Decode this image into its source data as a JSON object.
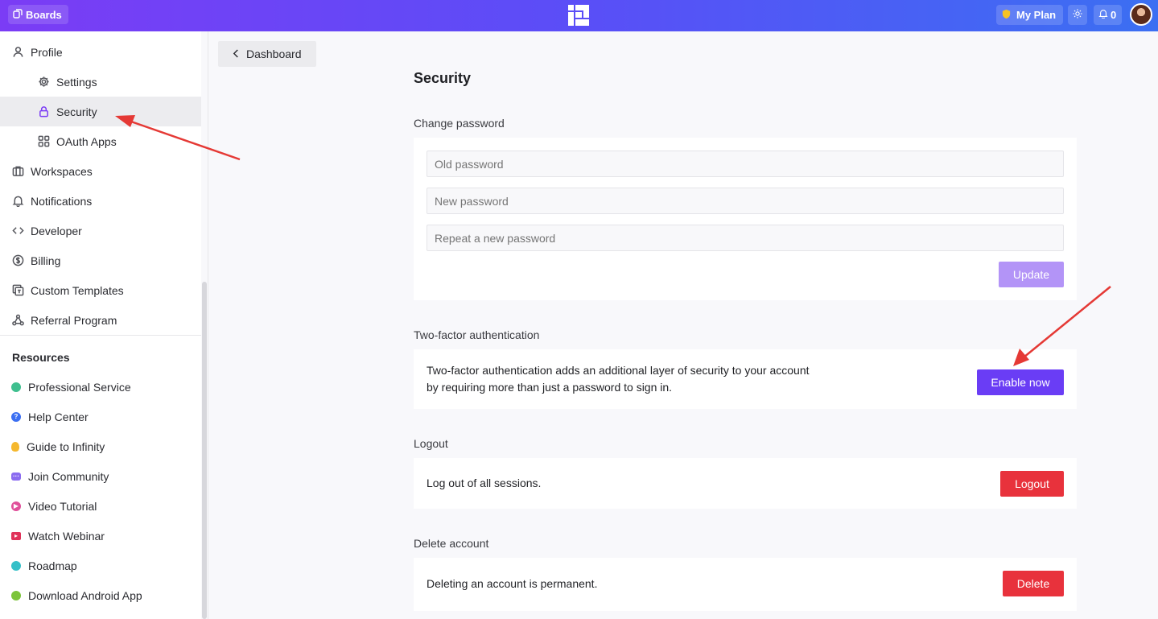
{
  "topbar": {
    "boards_label": "Boards",
    "plan_label": "My Plan",
    "notification_count": "0"
  },
  "sidebar": {
    "items": [
      {
        "label": "Profile",
        "icon": "user-icon"
      },
      {
        "label": "Settings",
        "icon": "gear-icon"
      },
      {
        "label": "Security",
        "icon": "lock-icon"
      },
      {
        "label": "OAuth Apps",
        "icon": "grid-icon"
      },
      {
        "label": "Workspaces",
        "icon": "briefcase-icon"
      },
      {
        "label": "Notifications",
        "icon": "bell-icon"
      },
      {
        "label": "Developer",
        "icon": "code-icon"
      },
      {
        "label": "Billing",
        "icon": "dollar-icon"
      },
      {
        "label": "Custom Templates",
        "icon": "template-icon"
      },
      {
        "label": "Referral Program",
        "icon": "referral-icon"
      }
    ],
    "resources_title": "Resources",
    "resources": [
      {
        "label": "Professional Service",
        "color": "#3fbf8f"
      },
      {
        "label": "Help Center",
        "color": "#3b6ff2"
      },
      {
        "label": "Guide to Infinity",
        "color": "#f5b82e"
      },
      {
        "label": "Join Community",
        "color": "#8b6cf0"
      },
      {
        "label": "Video Tutorial",
        "color": "#e0509a"
      },
      {
        "label": "Watch Webinar",
        "color": "#e0335a"
      },
      {
        "label": "Roadmap",
        "color": "#36c0c8"
      },
      {
        "label": "Download Android App",
        "color": "#7cc43a"
      }
    ]
  },
  "main": {
    "back_label": "Dashboard",
    "title": "Security",
    "change_password": {
      "label": "Change password",
      "old_placeholder": "Old password",
      "new_placeholder": "New password",
      "repeat_placeholder": "Repeat a new password",
      "update_label": "Update"
    },
    "two_factor": {
      "label": "Two-factor authentication",
      "line1": "Two-factor authentication adds an additional layer of security to your account",
      "line2": "by requiring more than just a password to sign in.",
      "enable_label": "Enable now"
    },
    "logout": {
      "label": "Logout",
      "text": "Log out of all sessions.",
      "button_label": "Logout"
    },
    "delete_account": {
      "label": "Delete account",
      "text": "Deleting an account is permanent.",
      "button_label": "Delete"
    }
  },
  "colors": {
    "accent": "#6a3df5",
    "accent_disabled": "#b394f7",
    "danger": "#e8323c",
    "annotation": "#e53935"
  }
}
